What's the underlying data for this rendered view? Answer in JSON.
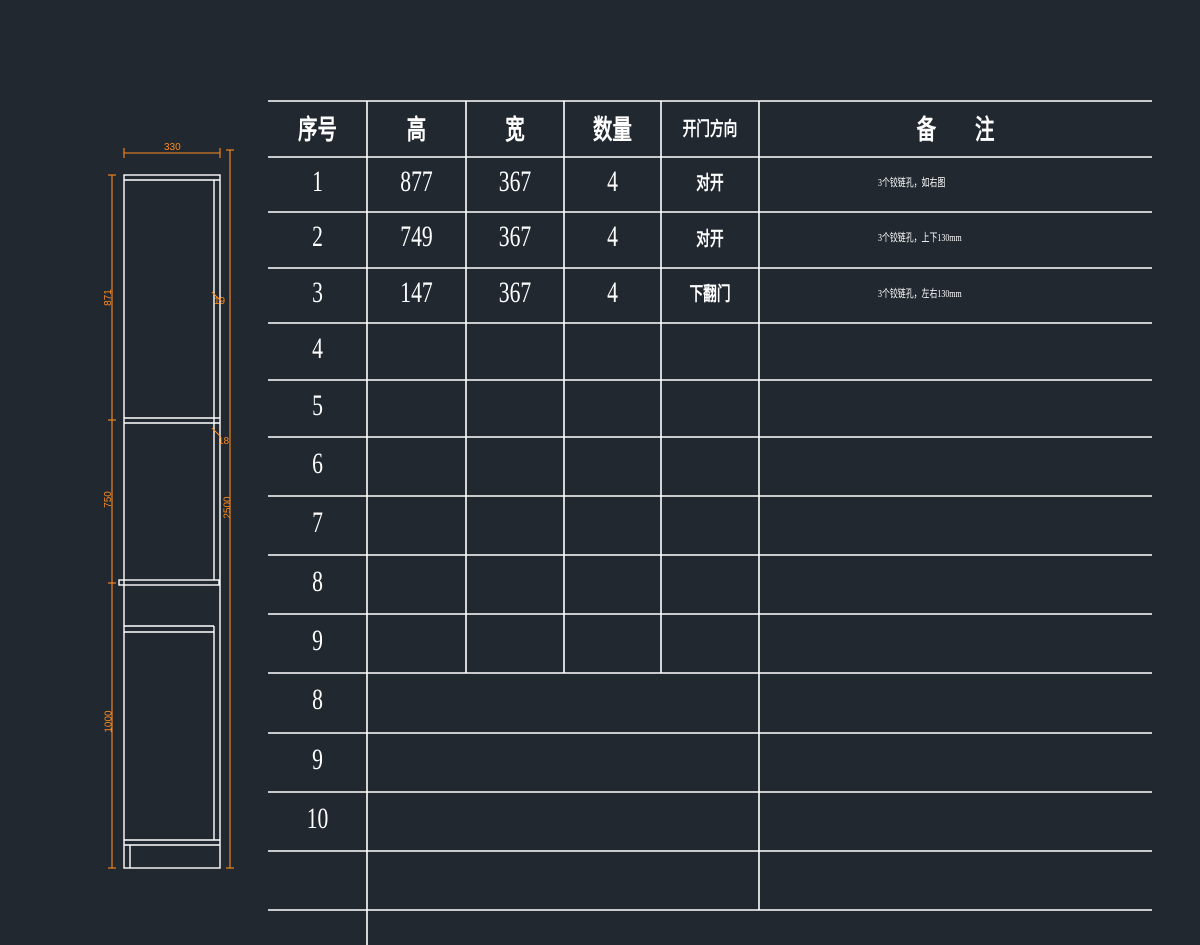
{
  "table": {
    "headers": [
      "序号",
      "高",
      "宽",
      "数量",
      "开门方向",
      "备　　注"
    ],
    "rows": [
      {
        "index": "1",
        "height": "877",
        "width": "367",
        "qty": "4",
        "door": "对开",
        "note": "3个铰链孔，如右图"
      },
      {
        "index": "2",
        "height": "749",
        "width": "367",
        "qty": "4",
        "door": "对开",
        "note": "3个铰链孔，上下130mm"
      },
      {
        "index": "3",
        "height": "147",
        "width": "367",
        "qty": "4",
        "door": "下翻门",
        "note": "3个铰链孔，左右130mm"
      },
      {
        "index": "4"
      },
      {
        "index": "5"
      },
      {
        "index": "6"
      },
      {
        "index": "7"
      },
      {
        "index": "8"
      },
      {
        "index": "9"
      },
      {
        "index": "8"
      },
      {
        "index": "9"
      },
      {
        "index": "10"
      },
      {
        "index": ""
      }
    ]
  },
  "drawing": {
    "dims": {
      "top_width": "330",
      "left_upper": "871",
      "left_middle": "750",
      "left_lower": "1000",
      "right_middle": "2500",
      "right_small_1": "19",
      "right_small_2": "18"
    }
  },
  "colors": {
    "background": "#212830",
    "lines": "#ffffff",
    "dimension": "#ff8a1f"
  }
}
